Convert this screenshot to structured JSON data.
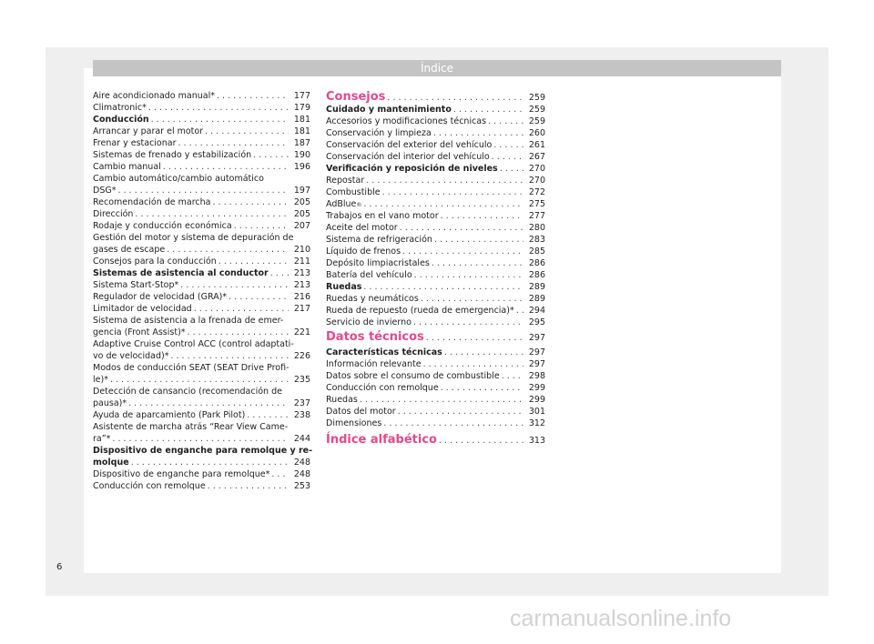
{
  "header": {
    "title": "Índice"
  },
  "left_entries": [
    {
      "lines": [
        "Aire acondicionado manual*"
      ],
      "page": "177",
      "style": "normal"
    },
    {
      "lines": [
        "Climatronic*"
      ],
      "page": "179",
      "style": "normal"
    },
    {
      "lines": [
        "Conducción"
      ],
      "page": "181",
      "style": "bold"
    },
    {
      "lines": [
        "Arrancar y parar el motor"
      ],
      "page": "181",
      "style": "normal"
    },
    {
      "lines": [
        "Frenar y estacionar"
      ],
      "page": "187",
      "style": "normal"
    },
    {
      "lines": [
        "Sistemas de frenado y estabilización"
      ],
      "page": "190",
      "style": "normal"
    },
    {
      "lines": [
        "Cambio manual"
      ],
      "page": "196",
      "style": "normal"
    },
    {
      "lines": [
        "Cambio automático/cambio automático",
        "DSG*"
      ],
      "page": "197",
      "style": "normal"
    },
    {
      "lines": [
        "Recomendación de marcha"
      ],
      "page": "205",
      "style": "normal"
    },
    {
      "lines": [
        "Dirección"
      ],
      "page": "205",
      "style": "normal"
    },
    {
      "lines": [
        "Rodaje y conducción económica"
      ],
      "page": "207",
      "style": "normal"
    },
    {
      "lines": [
        "Gestión del motor y sistema de depuración de",
        "gases de escape"
      ],
      "page": "210",
      "style": "normal"
    },
    {
      "lines": [
        "Consejos para la conducción"
      ],
      "page": "211",
      "style": "normal"
    },
    {
      "lines": [
        "Sistemas de asistencia al conductor"
      ],
      "page": "213",
      "style": "bold"
    },
    {
      "lines": [
        "Sistema Start-Stop*"
      ],
      "page": "213",
      "style": "normal"
    },
    {
      "lines": [
        "Regulador de velocidad (GRA)*"
      ],
      "page": "216",
      "style": "normal"
    },
    {
      "lines": [
        "Limitador de velocidad"
      ],
      "page": "217",
      "style": "normal"
    },
    {
      "lines": [
        "Sistema de asistencia a la frenada de emer-",
        "gencia (Front Assist)*"
      ],
      "page": "221",
      "style": "normal"
    },
    {
      "lines": [
        "Adaptive Cruise Control ACC (control adaptati-",
        "vo de velocidad)*"
      ],
      "page": "226",
      "style": "normal"
    },
    {
      "lines": [
        "Modos de conducción SEAT (SEAT Drive Profi-",
        "le)*"
      ],
      "page": "235",
      "style": "normal"
    },
    {
      "lines": [
        "Detección de cansancio (recomendación de",
        "pausa)*"
      ],
      "page": "237",
      "style": "normal"
    },
    {
      "lines": [
        "Ayuda de aparcamiento (Park Pilot)"
      ],
      "page": "238",
      "style": "normal"
    },
    {
      "lines": [
        "Asistente de marcha atrás “Rear View Came-",
        "ra”*"
      ],
      "page": "244",
      "style": "normal"
    },
    {
      "lines": [
        "Dispositivo de enganche para remolque y re-",
        "molque"
      ],
      "page": "248",
      "style": "bold"
    },
    {
      "lines": [
        "Dispositivo de enganche para remolque*"
      ],
      "page": "248",
      "style": "normal"
    },
    {
      "lines": [
        "Conducción con remolque"
      ],
      "page": "253",
      "style": "normal"
    }
  ],
  "right_entries": [
    {
      "lines": [
        "Consejos"
      ],
      "page": "259",
      "style": "heading"
    },
    {
      "lines": [
        "Cuidado y mantenimiento"
      ],
      "page": "259",
      "style": "bold"
    },
    {
      "lines": [
        "Accesorios y modificaciones técnicas"
      ],
      "page": "259",
      "style": "normal"
    },
    {
      "lines": [
        "Conservación y limpieza"
      ],
      "page": "260",
      "style": "normal"
    },
    {
      "lines": [
        "Conservación del exterior del vehículo"
      ],
      "page": "261",
      "style": "normal"
    },
    {
      "lines": [
        "Conservación del interior del vehículo"
      ],
      "page": "267",
      "style": "normal"
    },
    {
      "lines": [
        "Verificación y reposición de niveles"
      ],
      "page": "270",
      "style": "bold"
    },
    {
      "lines": [
        "Repostar"
      ],
      "page": "270",
      "style": "normal"
    },
    {
      "lines": [
        "Combustible"
      ],
      "page": "272",
      "style": "normal"
    },
    {
      "lines": [
        "AdBlue"
      ],
      "sup": "®",
      "page": "275",
      "style": "normal"
    },
    {
      "lines": [
        "Trabajos en el vano motor"
      ],
      "page": "277",
      "style": "normal"
    },
    {
      "lines": [
        "Aceite del motor"
      ],
      "page": "280",
      "style": "normal"
    },
    {
      "lines": [
        "Sistema de refrigeración"
      ],
      "page": "283",
      "style": "normal"
    },
    {
      "lines": [
        "Líquido de frenos"
      ],
      "page": "285",
      "style": "normal"
    },
    {
      "lines": [
        "Depósito limpiacristales"
      ],
      "page": "286",
      "style": "normal"
    },
    {
      "lines": [
        "Batería del vehículo"
      ],
      "page": "286",
      "style": "normal"
    },
    {
      "lines": [
        "Ruedas"
      ],
      "page": "289",
      "style": "bold"
    },
    {
      "lines": [
        "Ruedas y neumáticos"
      ],
      "page": "289",
      "style": "normal"
    },
    {
      "lines": [
        "Rueda de repuesto (rueda de emergencia)*"
      ],
      "page": "294",
      "style": "normal"
    },
    {
      "lines": [
        "Servicio de invierno"
      ],
      "page": "295",
      "style": "normal"
    },
    {
      "lines": [
        "Datos técnicos"
      ],
      "page": "297",
      "style": "heading"
    },
    {
      "lines": [
        "Características técnicas"
      ],
      "page": "297",
      "style": "bold"
    },
    {
      "lines": [
        "Información relevante"
      ],
      "page": "297",
      "style": "normal"
    },
    {
      "lines": [
        "Datos sobre el consumo de combustible"
      ],
      "page": "298",
      "style": "normal"
    },
    {
      "lines": [
        "Conducción con remolque"
      ],
      "page": "299",
      "style": "normal"
    },
    {
      "lines": [
        "Ruedas"
      ],
      "page": "299",
      "style": "normal"
    },
    {
      "lines": [
        "Datos del motor"
      ],
      "page": "301",
      "style": "normal"
    },
    {
      "lines": [
        "Dimensiones"
      ],
      "page": "312",
      "style": "normal"
    },
    {
      "lines": [
        "Índice alfabético"
      ],
      "page": "313",
      "style": "heading"
    }
  ],
  "footer": {
    "page_number": "6"
  },
  "watermark": {
    "text": "carmanualsonline.info"
  },
  "colors": {
    "accent": "#e8478b",
    "header_bg": "#c4c4c4",
    "frame_bg": "#efefef"
  }
}
